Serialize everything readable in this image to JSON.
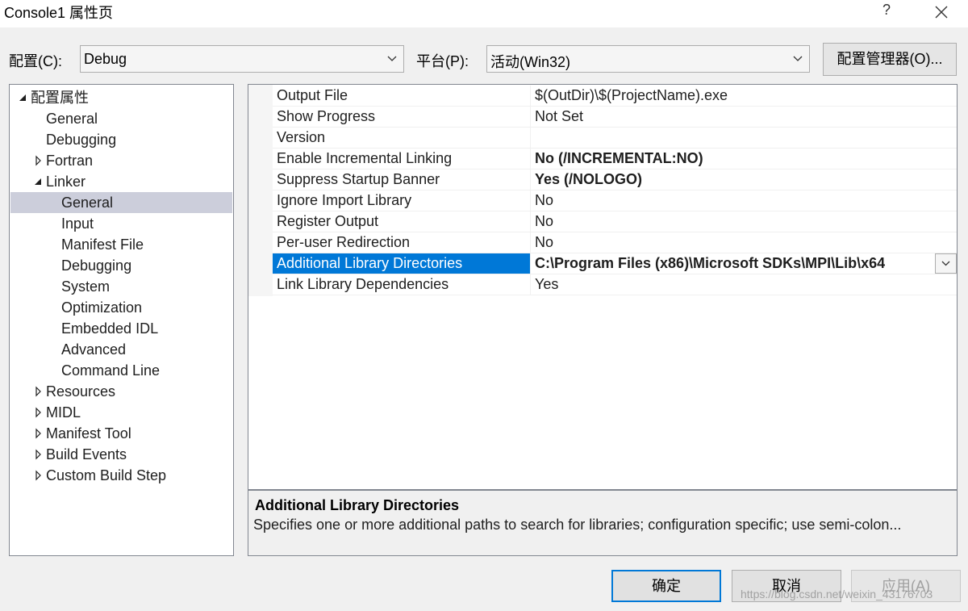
{
  "window": {
    "title": "Console1 属性页",
    "help_glyph": "?",
    "close_glyph": "✕"
  },
  "config_bar": {
    "config_label": "配置(C):",
    "config_value": "Debug",
    "platform_label": "平台(P):",
    "platform_value": "活动(Win32)",
    "manager_button": "配置管理器(O)..."
  },
  "tree": {
    "items": [
      {
        "label": "配置属性",
        "expander": "expanded"
      },
      {
        "label": "General",
        "expander": "none"
      },
      {
        "label": "Debugging",
        "expander": "none"
      },
      {
        "label": "Fortran",
        "expander": "collapsed"
      },
      {
        "label": "Linker",
        "expander": "expanded"
      },
      {
        "label": "General",
        "expander": "none",
        "selected": true
      },
      {
        "label": "Input",
        "expander": "none"
      },
      {
        "label": "Manifest File",
        "expander": "none"
      },
      {
        "label": "Debugging",
        "expander": "none"
      },
      {
        "label": "System",
        "expander": "none"
      },
      {
        "label": "Optimization",
        "expander": "none"
      },
      {
        "label": "Embedded IDL",
        "expander": "none"
      },
      {
        "label": "Advanced",
        "expander": "none"
      },
      {
        "label": "Command Line",
        "expander": "none"
      },
      {
        "label": "Resources",
        "expander": "collapsed"
      },
      {
        "label": "MIDL",
        "expander": "collapsed"
      },
      {
        "label": "Manifest Tool",
        "expander": "collapsed"
      },
      {
        "label": "Build Events",
        "expander": "collapsed"
      },
      {
        "label": "Custom Build Step",
        "expander": "collapsed"
      }
    ]
  },
  "properties": {
    "rows": [
      {
        "name": "Output File",
        "value": "$(OutDir)\\$(ProjectName).exe",
        "bold": false
      },
      {
        "name": "Show Progress",
        "value": "Not Set",
        "bold": false
      },
      {
        "name": "Version",
        "value": "",
        "bold": false
      },
      {
        "name": "Enable Incremental Linking",
        "value": "No (/INCREMENTAL:NO)",
        "bold": true
      },
      {
        "name": "Suppress Startup Banner",
        "value": "Yes (/NOLOGO)",
        "bold": true
      },
      {
        "name": "Ignore Import Library",
        "value": "No",
        "bold": false
      },
      {
        "name": "Register Output",
        "value": "No",
        "bold": false
      },
      {
        "name": "Per-user Redirection",
        "value": "No",
        "bold": false
      },
      {
        "name": "Additional Library Directories",
        "value": "C:\\Program Files (x86)\\Microsoft SDKs\\MPI\\Lib\\x64",
        "bold": true,
        "selected": true
      },
      {
        "name": "Link Library Dependencies",
        "value": "Yes",
        "bold": false
      }
    ]
  },
  "description": {
    "title": "Additional Library Directories",
    "text": "Specifies one or more additional paths to search for libraries; configuration specific; use semi-colon..."
  },
  "buttons": {
    "ok": "确定",
    "cancel": "取消",
    "apply": "应用(A)"
  },
  "watermark": "https://blog.csdn.net/weixin_43176703",
  "colors": {
    "selection_blue": "#0078d7",
    "tree_selection": "#cccedb",
    "window_bg": "#f0f0f0"
  }
}
